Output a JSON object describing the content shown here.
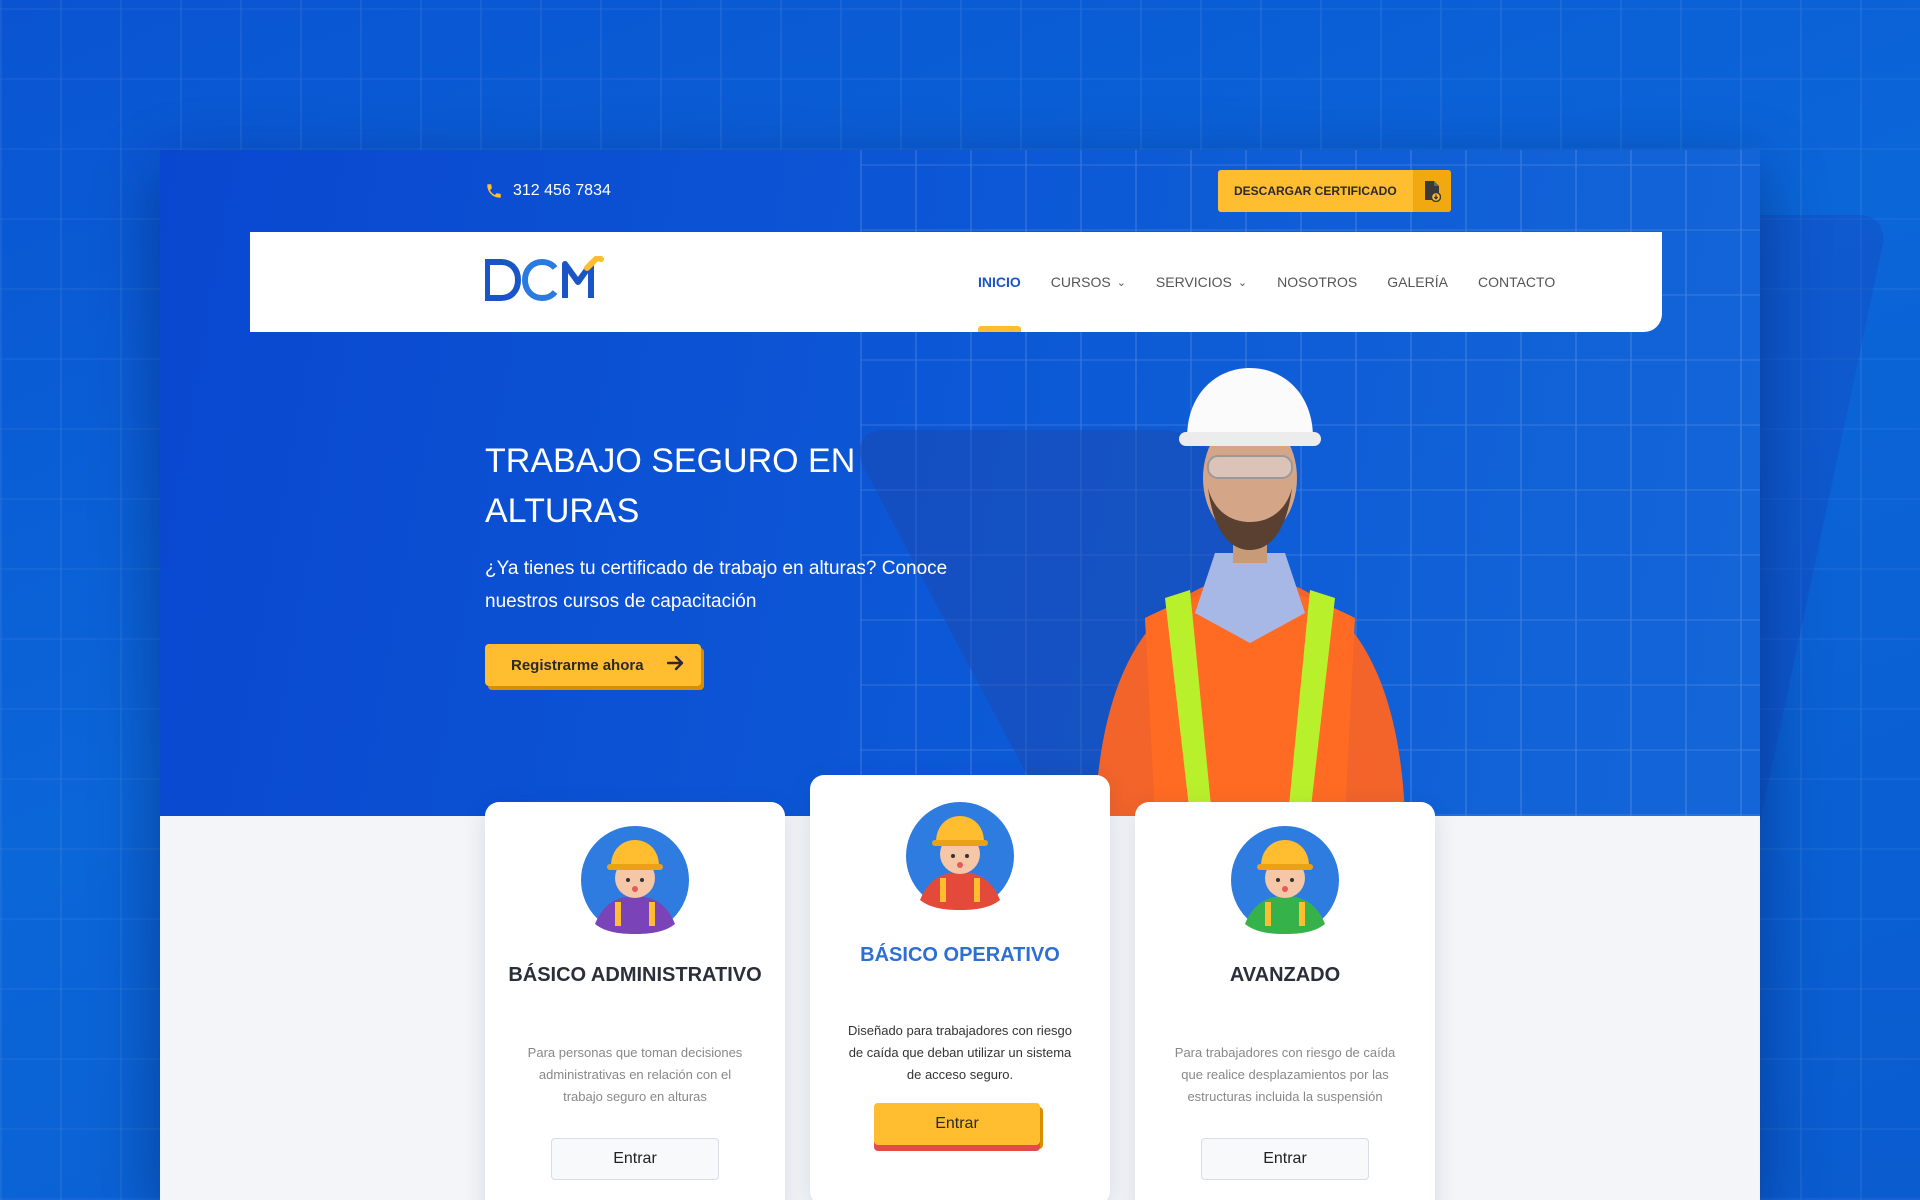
{
  "topbar": {
    "phone": "312 456 7834",
    "certificate_button": "DESCARGAR CERTIFICADO"
  },
  "brand": {
    "logo_text": "DCM"
  },
  "nav": {
    "items": [
      {
        "label": "INICIO",
        "active": true
      },
      {
        "label": "CURSOS",
        "dropdown": true
      },
      {
        "label": "SERVICIOS",
        "dropdown": true
      },
      {
        "label": "NOSOTROS"
      },
      {
        "label": "GALERÍA"
      },
      {
        "label": "CONTACTO"
      }
    ]
  },
  "hero": {
    "title": "TRABAJO SEGURO EN ALTURAS",
    "subtitle": "¿Ya tienes tu certificado de trabajo en alturas? Conoce nuestros cursos de capacitación",
    "cta": "Registrarme ahora"
  },
  "cards": [
    {
      "title": "BÁSICO ADMINISTRATIVO",
      "description": "Para personas que toman decisiones administrativas en relación con el trabajo seguro en alturas",
      "button": "Entrar"
    },
    {
      "title": "BÁSICO OPERATIVO",
      "description": "Diseñado para trabajadores con riesgo de caída que deban utilizar un sistema de acceso seguro.",
      "button": "Entrar"
    },
    {
      "title": "AVANZADO",
      "description": "Para trabajadores con riesgo de caída que realice desplazamientos por las estructuras incluida la suspensión",
      "button": "Entrar"
    }
  ],
  "colors": {
    "primary_blue": "#0a4fd0",
    "accent_yellow": "#ffbd2f",
    "nav_active": "#1a55c8"
  },
  "icons": [
    "phone-icon",
    "download-file-icon",
    "chevron-down-icon",
    "arrow-right-icon"
  ]
}
